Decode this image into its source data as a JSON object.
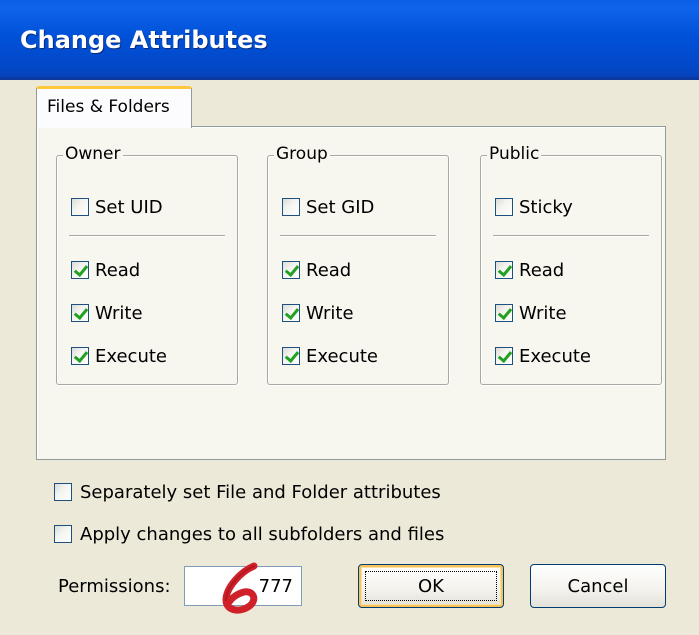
{
  "window": {
    "title": "Change Attributes"
  },
  "tabs": [
    {
      "label": "Files & Folders",
      "active": true
    }
  ],
  "groups": [
    {
      "legend": "Owner",
      "special": {
        "label": "Set UID",
        "checked": false
      },
      "perms": [
        {
          "label": "Read",
          "checked": true
        },
        {
          "label": "Write",
          "checked": true
        },
        {
          "label": "Execute",
          "checked": true
        }
      ]
    },
    {
      "legend": "Group",
      "special": {
        "label": "Set GID",
        "checked": false
      },
      "perms": [
        {
          "label": "Read",
          "checked": true
        },
        {
          "label": "Write",
          "checked": true
        },
        {
          "label": "Execute",
          "checked": true
        }
      ]
    },
    {
      "legend": "Public",
      "special": {
        "label": "Sticky",
        "checked": false
      },
      "perms": [
        {
          "label": "Read",
          "checked": true
        },
        {
          "label": "Write",
          "checked": true
        },
        {
          "label": "Execute",
          "checked": true
        }
      ]
    }
  ],
  "options": [
    {
      "label": "Separately set File and Folder attributes",
      "checked": false
    },
    {
      "label": "Apply changes to all subfolders and files",
      "checked": false
    }
  ],
  "permissions": {
    "label": "Permissions:",
    "value": "777"
  },
  "buttons": {
    "ok": "OK",
    "cancel": "Cancel"
  },
  "colors": {
    "titlebar": "#0051d8",
    "dialog_bg": "#ece9d8",
    "tab_highlight": "#ffc83c",
    "checkmark": "#21a121",
    "annotation_marker": "#d0202a"
  },
  "annotation": {
    "icon": "step-6-marker-icon"
  }
}
